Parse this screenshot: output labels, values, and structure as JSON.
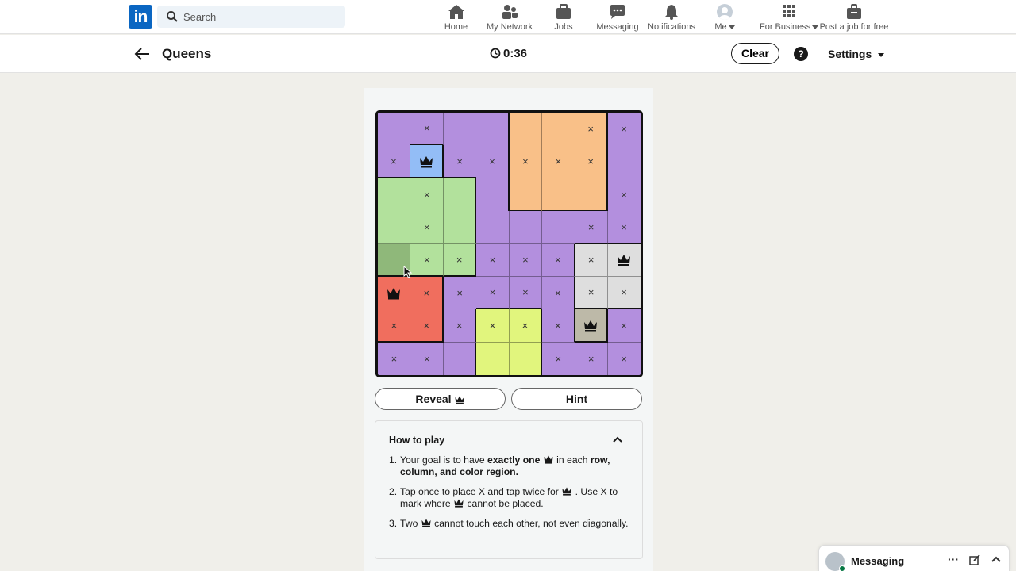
{
  "nav": {
    "logo": "in",
    "search_placeholder": "Search",
    "items": [
      {
        "label": "Home",
        "icon": "home-icon"
      },
      {
        "label": "My Network",
        "icon": "network-icon"
      },
      {
        "label": "Jobs",
        "icon": "jobs-icon"
      },
      {
        "label": "Messaging",
        "icon": "messaging-icon"
      },
      {
        "label": "Notifications",
        "icon": "bell-icon"
      },
      {
        "label": "Me",
        "icon": "avatar"
      },
      {
        "label": "For Business",
        "icon": "grid-icon"
      },
      {
        "label": "Post a job for free",
        "icon": "briefcase-plus-icon"
      }
    ]
  },
  "header": {
    "title": "Queens",
    "timer": "0:36",
    "clear_label": "Clear",
    "help_label": "?",
    "settings_label": "Settings"
  },
  "board": {
    "size": 8,
    "colors": {
      "P": "#b38fde",
      "O": "#f9c088",
      "B": "#93bdf6",
      "G": "#b2e19c",
      "D": "#8fb87a",
      "L": "#dedede",
      "T": "#bdb9a8",
      "R": "#f06e5e",
      "Y": "#e1f57d"
    },
    "regions": [
      "PPPPOOOP",
      "PBPPOOOP",
      "GGGPOOOP",
      "GGGPPPPP",
      "DGGPPPLL",
      "RRPPPPLL",
      "RRPYYPTP",
      "PPPYYPPP"
    ],
    "marks": [
      "-x--- -x x",
      "xQxxxxx-",
      "-x-----x",
      "-x----xx",
      "-xxxxxxQ",
      "Qxxxxxxx",
      "xxxxxxQx",
      "xx---xxx"
    ],
    "x_mark": "×"
  },
  "actions": {
    "reveal_label": "Reveal",
    "hint_label": "Hint"
  },
  "howto": {
    "title": "How to play",
    "steps": [
      {
        "num": "1.",
        "t1": "Your goal is to have ",
        "b1": "exactly one",
        "t2": " in each ",
        "b2": "row, column, and color region."
      },
      {
        "num": "2.",
        "t1": "Tap once to place X and tap twice for",
        "t2": ". Use X to mark where",
        "t3": "cannot be placed."
      },
      {
        "num": "3.",
        "t1": "Two",
        "t2": "cannot touch each other, not even diagonally."
      }
    ]
  },
  "messaging": {
    "label": "Messaging",
    "more": "···"
  }
}
